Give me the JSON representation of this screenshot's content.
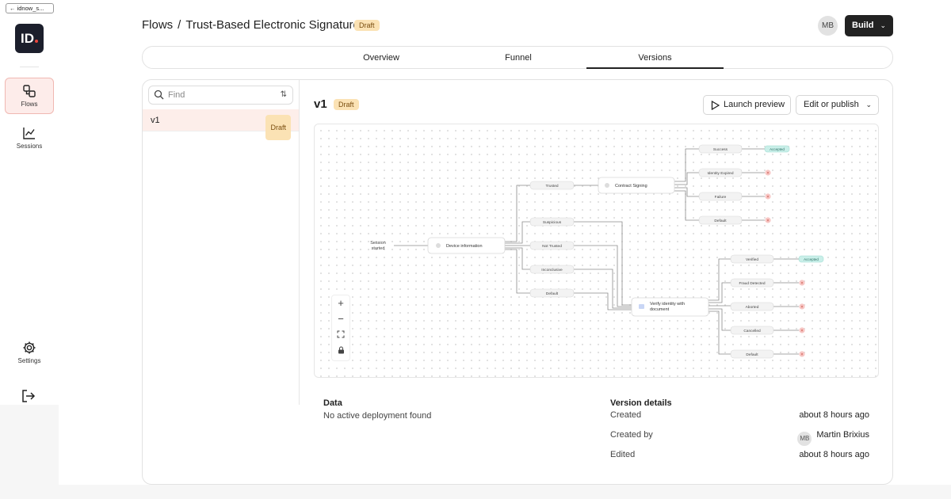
{
  "rail": {
    "crumb_label": "idnow_s...",
    "logo_text": "ID",
    "nav": [
      {
        "label": "Flows",
        "icon": "flows-icon"
      },
      {
        "label": "Sessions",
        "icon": "chart-icon"
      },
      {
        "label": "Settings",
        "icon": "gear-icon"
      }
    ]
  },
  "header": {
    "breadcrumb_root": "Flows",
    "breadcrumb_sep": "/",
    "flow_name": "Trust-Based Electronic Signature",
    "status_badge": "Draft",
    "avatar_initials": "MB",
    "build_label": "Build"
  },
  "tabs": [
    {
      "label": "Overview",
      "active": false
    },
    {
      "label": "Funnel",
      "active": false
    },
    {
      "label": "Versions",
      "active": true
    }
  ],
  "versions": {
    "search_placeholder": "Find",
    "items": [
      {
        "label": "v1",
        "badge": "Draft"
      }
    ]
  },
  "version_detail": {
    "title": "v1",
    "badge": "Draft",
    "launch_label": "Launch preview",
    "publish_label": "Edit or publish"
  },
  "flow": {
    "start": "Session started",
    "device": "Device information",
    "branches": [
      "Trusted",
      "Suspicious",
      "Not Trusted",
      "Inconclusive",
      "Default"
    ],
    "contract": "Contract Signing",
    "contract_outcomes": [
      "Success",
      "Identity Expired",
      "Failure",
      "Default"
    ],
    "contract_accepted": "Accepted",
    "verify": "Verify identity with document",
    "verify_outcomes": [
      "Verified",
      "Fraud Detected",
      "Aborted",
      "Cancelled",
      "Default"
    ],
    "verify_accepted": "Accepted"
  },
  "data": {
    "title": "Data",
    "text": "No active deployment found"
  },
  "details": {
    "title": "Version details",
    "created_label": "Created",
    "created_value": "about 8 hours ago",
    "created_by_label": "Created by",
    "created_by_initials": "MB",
    "created_by_value": "Martin Brixius",
    "edited_label": "Edited",
    "edited_value": "about 8 hours ago"
  },
  "colors": {
    "accent_draft_bg": "#fbe2b4",
    "accepted_bg": "#c9efe9",
    "reject_bg": "#f7c6c4",
    "active_nav_bg": "#fdecea"
  }
}
